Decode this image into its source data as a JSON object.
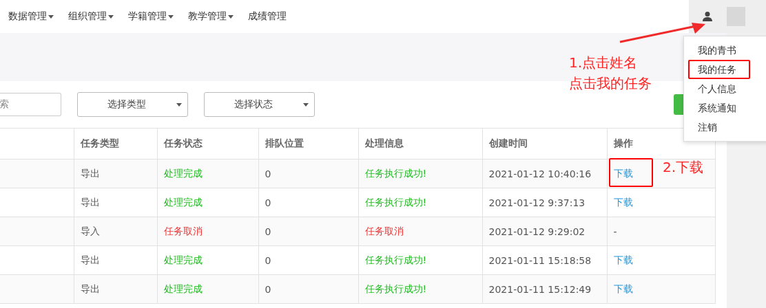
{
  "nav": {
    "items": [
      {
        "label": "数据管理",
        "dropdown": true
      },
      {
        "label": "组织管理",
        "dropdown": true
      },
      {
        "label": "学籍管理",
        "dropdown": true
      },
      {
        "label": "教学管理",
        "dropdown": true
      },
      {
        "label": "成绩管理",
        "dropdown": false
      }
    ]
  },
  "user_menu": {
    "items": [
      {
        "label": "我的青书",
        "annotated": false
      },
      {
        "label": "我的任务",
        "annotated": true
      },
      {
        "label": "个人信息",
        "annotated": false
      },
      {
        "label": "系统通知",
        "annotated": false
      },
      {
        "label": "注销",
        "annotated": false
      }
    ]
  },
  "filters": {
    "search": {
      "value": "索"
    },
    "selects": [
      {
        "placeholder": "选择类型"
      },
      {
        "placeholder": "选择状态"
      }
    ]
  },
  "table": {
    "columns": [
      "",
      "任务类型",
      "任务状态",
      "排队位置",
      "处理信息",
      "创建时间",
      "操作"
    ],
    "rows": [
      {
        "type": "导出",
        "kind": "done",
        "status": "处理完成",
        "queue": "0",
        "info": "任务执行成功!",
        "created": "2021-01-12 10:40:16",
        "action": "下载",
        "annotated": true
      },
      {
        "type": "导出",
        "kind": "done",
        "status": "处理完成",
        "queue": "0",
        "info": "任务执行成功!",
        "created": "2021-01-12 9:37:13",
        "action": "下载",
        "annotated": false
      },
      {
        "type": "导入",
        "kind": "cancelled",
        "status": "任务取消",
        "queue": "0",
        "info": "任务取消",
        "created": "2021-01-12 9:29:02",
        "action": "-",
        "annotated": false
      },
      {
        "type": "导出",
        "kind": "done",
        "status": "处理完成",
        "queue": "0",
        "info": "任务执行成功!",
        "created": "2021-01-11 15:18:58",
        "action": "下载",
        "annotated": false
      },
      {
        "type": "导出",
        "kind": "done",
        "status": "处理完成",
        "queue": "0",
        "info": "任务执行成功!",
        "created": "2021-01-11 15:12:49",
        "action": "下载",
        "annotated": false
      }
    ]
  },
  "annotations": {
    "step1": [
      "1.点击姓名",
      "点击我的任务"
    ],
    "step2": "2.下载"
  }
}
